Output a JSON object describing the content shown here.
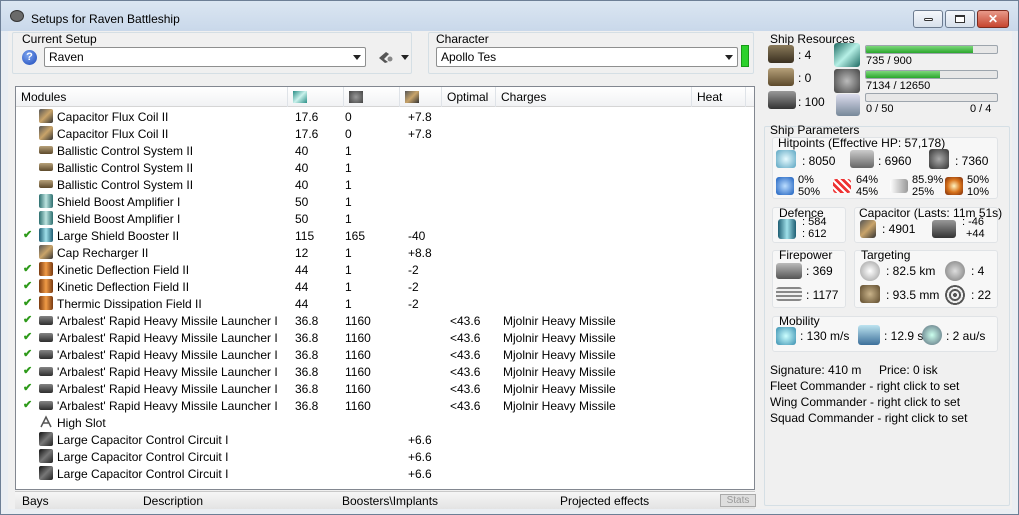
{
  "window": {
    "title": "Setups for Raven Battleship"
  },
  "setup": {
    "label": "Current Setup",
    "value": "Raven"
  },
  "character": {
    "label": "Character",
    "value": "Apollo Tes"
  },
  "columns": {
    "modules": "Modules",
    "optimal": "Optimal",
    "charges": "Charges",
    "heat": "Heat"
  },
  "modules": [
    {
      "checked": false,
      "icon": "capacitor-flux-coil-icon",
      "cls": "ri-cap",
      "name": "Capacitor Flux Coil II",
      "cpu": "17.6",
      "pg": "0",
      "cap": "+7.8",
      "optimal": "",
      "charges": ""
    },
    {
      "checked": false,
      "icon": "capacitor-flux-coil-icon",
      "cls": "ri-cap",
      "name": "Capacitor Flux Coil II",
      "cpu": "17.6",
      "pg": "0",
      "cap": "+7.8",
      "optimal": "",
      "charges": ""
    },
    {
      "checked": false,
      "icon": "ballistic-control-icon",
      "cls": "ri-bcs",
      "name": "Ballistic Control System II",
      "cpu": "40",
      "pg": "1",
      "cap": "",
      "optimal": "",
      "charges": ""
    },
    {
      "checked": false,
      "icon": "ballistic-control-icon",
      "cls": "ri-bcs",
      "name": "Ballistic Control System II",
      "cpu": "40",
      "pg": "1",
      "cap": "",
      "optimal": "",
      "charges": ""
    },
    {
      "checked": false,
      "icon": "ballistic-control-icon",
      "cls": "ri-bcs",
      "name": "Ballistic Control System II",
      "cpu": "40",
      "pg": "1",
      "cap": "",
      "optimal": "",
      "charges": ""
    },
    {
      "checked": false,
      "icon": "shield-boost-amplifier-icon",
      "cls": "ri-sba",
      "name": "Shield Boost Amplifier I",
      "cpu": "50",
      "pg": "1",
      "cap": "",
      "optimal": "",
      "charges": ""
    },
    {
      "checked": false,
      "icon": "shield-boost-amplifier-icon",
      "cls": "ri-sba",
      "name": "Shield Boost Amplifier I",
      "cpu": "50",
      "pg": "1",
      "cap": "",
      "optimal": "",
      "charges": ""
    },
    {
      "checked": true,
      "icon": "shield-booster-icon",
      "cls": "ri-lsb",
      "name": "Large Shield Booster II",
      "cpu": "115",
      "pg": "165",
      "cap": "-40",
      "optimal": "",
      "charges": ""
    },
    {
      "checked": false,
      "icon": "cap-recharger-icon",
      "cls": "ri-cap",
      "name": "Cap Recharger II",
      "cpu": "12",
      "pg": "1",
      "cap": "+8.8",
      "optimal": "",
      "charges": ""
    },
    {
      "checked": true,
      "icon": "deflection-field-icon",
      "cls": "ri-fld",
      "name": "Kinetic Deflection Field II",
      "cpu": "44",
      "pg": "1",
      "cap": "-2",
      "optimal": "",
      "charges": ""
    },
    {
      "checked": true,
      "icon": "deflection-field-icon",
      "cls": "ri-fld",
      "name": "Kinetic Deflection Field II",
      "cpu": "44",
      "pg": "1",
      "cap": "-2",
      "optimal": "",
      "charges": ""
    },
    {
      "checked": true,
      "icon": "dissipation-field-icon",
      "cls": "ri-fld",
      "name": "Thermic Dissipation Field II",
      "cpu": "44",
      "pg": "1",
      "cap": "-2",
      "optimal": "",
      "charges": ""
    },
    {
      "checked": true,
      "icon": "missile-launcher-icon",
      "cls": "ri-lnc",
      "name": "'Arbalest' Rapid Heavy Missile Launcher I",
      "cpu": "36.8",
      "pg": "1160",
      "cap": "",
      "optimal": "<43.6",
      "charges": "Mjolnir Heavy Missile"
    },
    {
      "checked": true,
      "icon": "missile-launcher-icon",
      "cls": "ri-lnc",
      "name": "'Arbalest' Rapid Heavy Missile Launcher I",
      "cpu": "36.8",
      "pg": "1160",
      "cap": "",
      "optimal": "<43.6",
      "charges": "Mjolnir Heavy Missile"
    },
    {
      "checked": true,
      "icon": "missile-launcher-icon",
      "cls": "ri-lnc",
      "name": "'Arbalest' Rapid Heavy Missile Launcher I",
      "cpu": "36.8",
      "pg": "1160",
      "cap": "",
      "optimal": "<43.6",
      "charges": "Mjolnir Heavy Missile"
    },
    {
      "checked": true,
      "icon": "missile-launcher-icon",
      "cls": "ri-lnc",
      "name": "'Arbalest' Rapid Heavy Missile Launcher I",
      "cpu": "36.8",
      "pg": "1160",
      "cap": "",
      "optimal": "<43.6",
      "charges": "Mjolnir Heavy Missile"
    },
    {
      "checked": true,
      "icon": "missile-launcher-icon",
      "cls": "ri-lnc",
      "name": "'Arbalest' Rapid Heavy Missile Launcher I",
      "cpu": "36.8",
      "pg": "1160",
      "cap": "",
      "optimal": "<43.6",
      "charges": "Mjolnir Heavy Missile"
    },
    {
      "checked": true,
      "icon": "missile-launcher-icon",
      "cls": "ri-lnc",
      "name": "'Arbalest' Rapid Heavy Missile Launcher I",
      "cpu": "36.8",
      "pg": "1160",
      "cap": "",
      "optimal": "<43.6",
      "charges": "Mjolnir Heavy Missile"
    },
    {
      "checked": false,
      "icon": "high-slot-icon",
      "cls": "ri-slot",
      "name": "High Slot",
      "cpu": "",
      "pg": "",
      "cap": "",
      "optimal": "",
      "charges": ""
    },
    {
      "checked": false,
      "icon": "control-circuit-icon",
      "cls": "ri-ccc",
      "name": "Large Capacitor Control Circuit I",
      "cpu": "",
      "pg": "",
      "cap": "+6.6",
      "optimal": "",
      "charges": ""
    },
    {
      "checked": false,
      "icon": "control-circuit-icon",
      "cls": "ri-ccc",
      "name": "Large Capacitor Control Circuit I",
      "cpu": "",
      "pg": "",
      "cap": "+6.6",
      "optimal": "",
      "charges": ""
    },
    {
      "checked": false,
      "icon": "control-circuit-icon",
      "cls": "ri-ccc",
      "name": "Large Capacitor Control Circuit I",
      "cpu": "",
      "pg": "",
      "cap": "+6.6",
      "optimal": "",
      "charges": ""
    }
  ],
  "bottom_tabs": [
    "Bays",
    "Description",
    "Boosters\\Implants",
    "Projected effects"
  ],
  "stats_button": "Stats",
  "resources": {
    "title": "Ship Resources",
    "turrets": ": 4",
    "launchers": ": 0",
    "drones": ": 100",
    "cpu": {
      "text": "735 / 900",
      "fraction": 0.817
    },
    "powergrid": {
      "text": "7134 / 12650",
      "fraction": 0.564
    },
    "calibration": {
      "text": "0 / 50",
      "fraction": 0
    },
    "rigs": "0 / 4"
  },
  "params": {
    "title": "Ship Parameters",
    "hitpoints_title": "Hitpoints (Effective HP: 57,178)",
    "shield_hp": ": 8050",
    "armor_hp": ": 6960",
    "structure_hp": ": 7360",
    "em": {
      "top": "0%",
      "bottom": "50%"
    },
    "thermal": {
      "top": "64%",
      "bottom": "45%"
    },
    "kinetic": {
      "top": "85.9%",
      "bottom": "25%"
    },
    "explosive": {
      "top": "50%",
      "bottom": "10%"
    },
    "defence_title": "Defence",
    "defence_top": ": 584",
    "defence_bottom": ": 612",
    "capacitor_title": "Capacitor (Lasts: 11m 51s)",
    "capacitor_amount": ": 4901",
    "capacitor_use": ": -46",
    "capacitor_recharge": "+44",
    "firepower_title": "Firepower",
    "dps": ": 369",
    "volley": ": 1177",
    "targeting_title": "Targeting",
    "range": ": 82.5 km",
    "targets": ": 4",
    "scan_res": ": 93.5 mm",
    "sensor": ": 22",
    "mobility_title": "Mobility",
    "speed": ": 130 m/s",
    "align": ": 12.9 s",
    "warp": ": 2 au/s",
    "signature": "Signature: 410 m",
    "price": "Price: 0 isk",
    "fleet": "Fleet Commander - right click to set",
    "wing": "Wing Commander - right click to set",
    "squad": "Squad Commander - right click to set"
  },
  "colors": {
    "accent_green": "#2aa72c",
    "check_green": "#2e9a1a",
    "close_red": "#c6452f"
  }
}
